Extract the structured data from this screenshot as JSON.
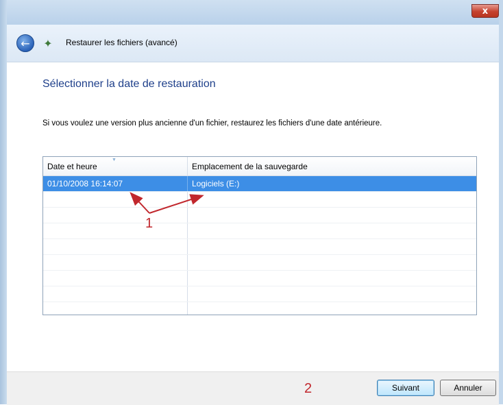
{
  "window": {
    "title": "Restaurer les fichiers (avancé)",
    "close_label": "x"
  },
  "nav": {
    "back_icon": "back-arrow-icon",
    "app_icon": "restore-files-icon"
  },
  "content": {
    "heading": "Sélectionner la date de restauration",
    "instructions": "Si vous voulez une version plus ancienne d'un fichier, restaurez les fichiers d'une date antérieure."
  },
  "table": {
    "columns": [
      "Date et heure",
      "Emplacement de la sauvegarde"
    ],
    "rows": [
      {
        "date": "01/10/2008 16:14:07",
        "location": "Logiciels (E:)",
        "selected": true
      }
    ]
  },
  "annotations": {
    "label_one": "1",
    "label_two": "2",
    "color": "#c1272d"
  },
  "buttons": {
    "next": "Suivant",
    "cancel": "Annuler"
  },
  "colors": {
    "selection": "#3d8ee6",
    "heading": "#1e3f8a"
  }
}
